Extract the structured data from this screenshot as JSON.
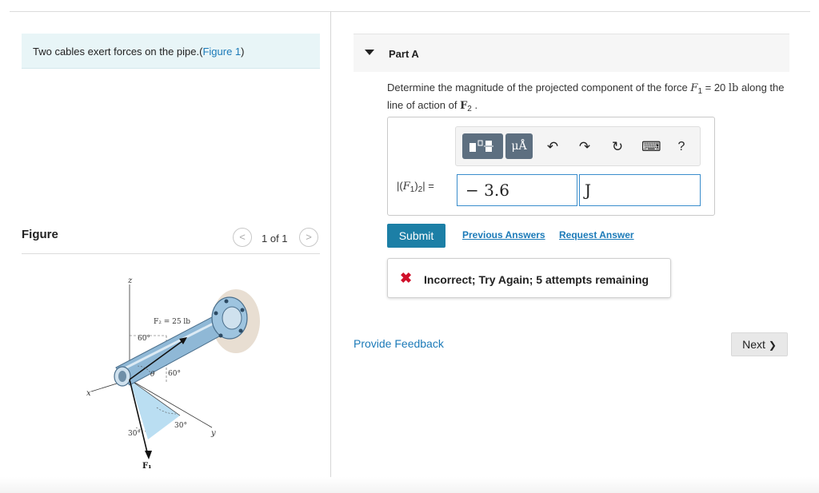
{
  "intro": {
    "text": "Two cables exert forces on the pipe.(",
    "link": "Figure 1",
    "close": ")"
  },
  "figure": {
    "title": "Figure",
    "pager": "1 of 1",
    "prev_glyph": "<",
    "next_glyph": ">",
    "labels": {
      "z": "z",
      "x": "x",
      "y": "y",
      "f2": "F₂ = 25 lb",
      "a60_top": "60°",
      "theta": "θ",
      "a60_mid": "60°",
      "a30_right": "30°",
      "a30_left": "30°",
      "f1": "F₁"
    }
  },
  "part": {
    "title": "Part A"
  },
  "question": {
    "pre": "Determine the magnitude of the projected component of the force ",
    "f1_sym": "F",
    "f1_sub": "1",
    "eq": " = 20 ",
    "unit": "lb",
    "mid": " along the line of action of ",
    "f2_sym": "F",
    "f2_sub": "2",
    "end": " ."
  },
  "toolbar": {
    "mu": "μÅ",
    "undo": "↶",
    "redo": "↷",
    "reset": "↻",
    "keyboard": "⌨",
    "help": "?"
  },
  "answer": {
    "label_open": "|(",
    "label_sym": "F",
    "label_sub1": "1",
    "label_close": ")",
    "label_sub2": "2",
    "label_end": "| =",
    "value": "− 3.6",
    "unit": "J"
  },
  "actions": {
    "submit": "Submit",
    "previous_answers": "Previous Answers",
    "request_answer": "Request Answer"
  },
  "feedback": {
    "icon": "✖",
    "message": "Incorrect; Try Again; 5 attempts remaining"
  },
  "footer": {
    "provide_feedback": "Provide Feedback",
    "next": "Next",
    "next_glyph": "❯"
  },
  "colors": {
    "link": "#1b7ab8",
    "submit_bg": "#1c7fa6",
    "error": "#d0112b",
    "intro_bg": "#e8f5f7"
  }
}
